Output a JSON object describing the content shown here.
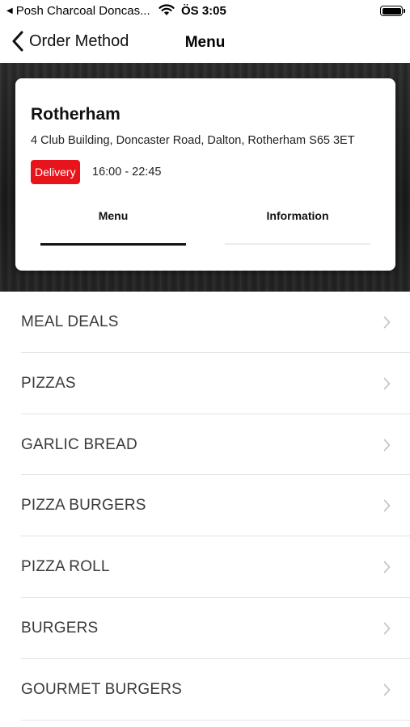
{
  "status_bar": {
    "back_app": "Posh Charcoal Doncas...",
    "time": "ÖS 3:05"
  },
  "nav": {
    "back_label": "Order Method",
    "title": "Menu"
  },
  "store": {
    "name": "Rotherham",
    "address": "4 Club Building, Doncaster Road, Dalton, Rotherham S65 3ET",
    "method_badge": "Delivery",
    "hours": "16:00 - 22:45"
  },
  "tabs": [
    {
      "label": "Menu",
      "active": true
    },
    {
      "label": "Information",
      "active": false
    }
  ],
  "categories": [
    "MEAL DEALS",
    "PIZZAS",
    "GARLIC BREAD",
    "PIZZA BURGERS",
    "PIZZA ROLL",
    "BURGERS",
    "GOURMET BURGERS"
  ],
  "colors": {
    "accent": "#e8141c",
    "hero_background": "#222222"
  }
}
